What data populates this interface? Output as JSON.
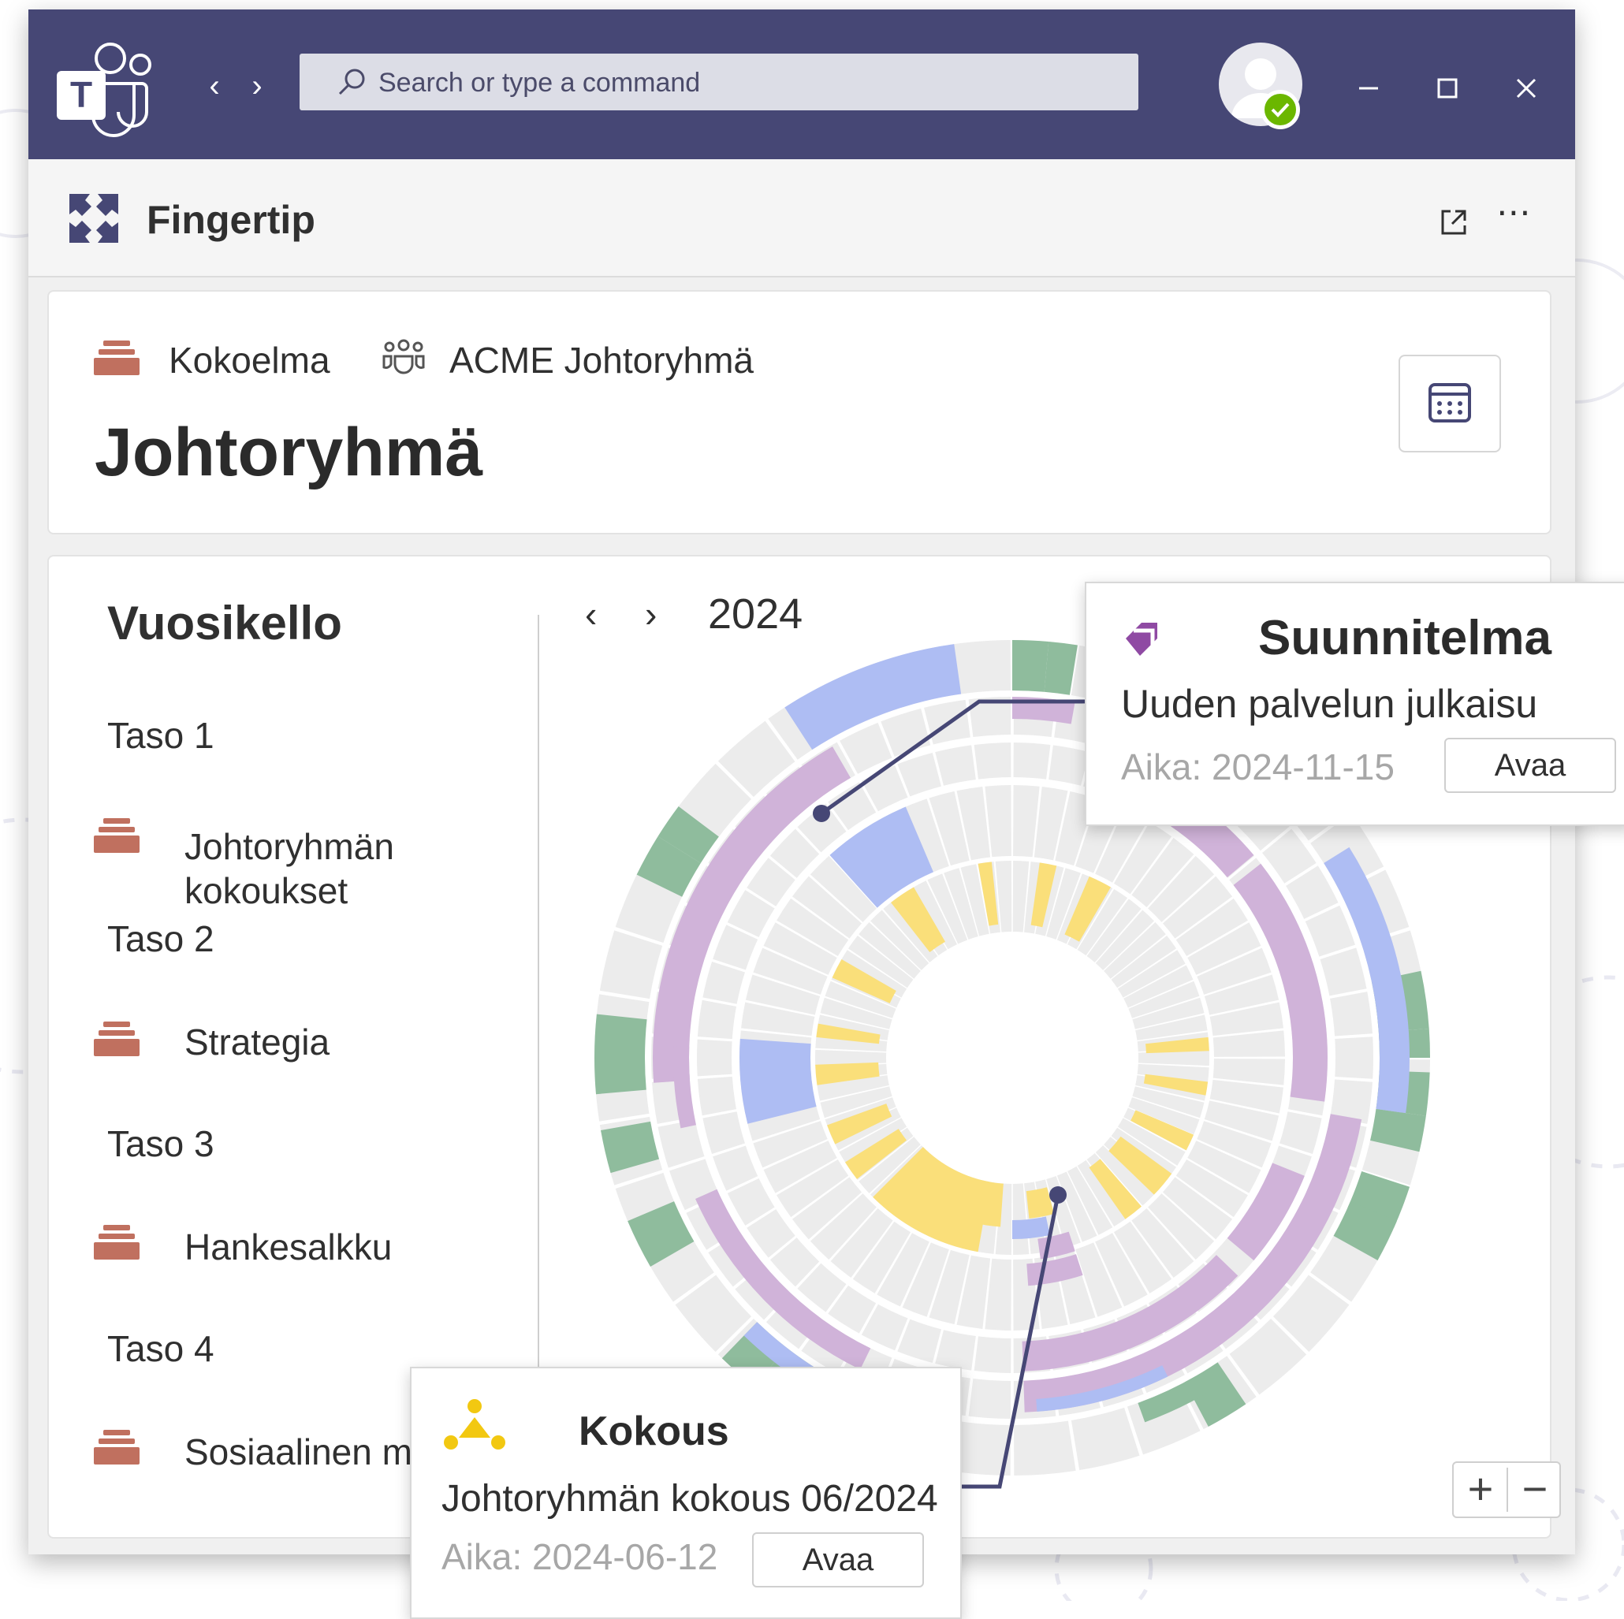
{
  "titlebar": {
    "search_placeholder": "Search or type a command",
    "back_label": "‹",
    "forward_label": "›"
  },
  "app": {
    "name": "Fingertip"
  },
  "header": {
    "breadcrumb_collection": "Kokoelma",
    "breadcrumb_team": "ACME Johtoryhmä",
    "title": "Johtoryhmä"
  },
  "sidebar": {
    "title": "Vuosikello",
    "levels": [
      {
        "label": "Taso 1",
        "item": "Johtoryhmän kokoukset"
      },
      {
        "label": "Taso 2",
        "item": "Strategia"
      },
      {
        "label": "Taso 3",
        "item": "Hankesalkku"
      },
      {
        "label": "Taso 4",
        "item": "Sosiaalinen m"
      }
    ]
  },
  "calendar": {
    "year": "2024",
    "prev_label": "‹",
    "next_label": "›",
    "zoom_in": "+",
    "zoom_out": "−"
  },
  "popups": {
    "plan": {
      "title": "Suunnitelma",
      "name": "Uuden palvelun julkaisu",
      "date": "Aika: 2024-11-15",
      "button": "Avaa"
    },
    "meeting": {
      "title": "Kokous",
      "name": "Johtoryhmän kokous 06/2024",
      "date": "Aika: 2024-06-12",
      "button": "Avaa"
    }
  },
  "colors": {
    "titlebar": "#464775",
    "green": "#8fbc9d",
    "blue": "#aebdf3",
    "purple": "#d0b3d9",
    "yellow": "#fadf7a",
    "track": "#ececec",
    "stack_icon": "#c0705f",
    "plan_icon": "#8f4aa3",
    "meeting_icon": "#f2c811"
  }
}
